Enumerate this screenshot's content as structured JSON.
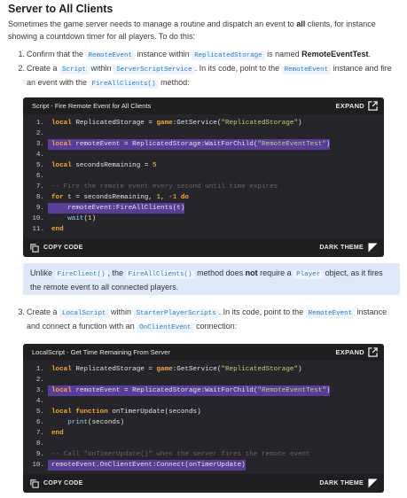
{
  "heading": "Server to All Clients",
  "intro": {
    "part1": "Sometimes the game server needs to manage a routine and dispatch an event to ",
    "bold": "all",
    "part2": " clients, for instance showing a countdown timer for all players. To do this:"
  },
  "steps": [
    {
      "num": "1.",
      "t1": "Confirm that the ",
      "tok1": "RemoteEvent",
      "t2": " instance within ",
      "tok2": "ReplicatedStorage",
      "t3": " is named ",
      "bold": "RemoteEventTest",
      "t4": "."
    },
    {
      "num": "2.",
      "t1": "Create a ",
      "tok1": "Script",
      "t2": " within ",
      "tok2": "ServerScriptService",
      "t3": ". In its code, point to the ",
      "tok3": "RemoteEvent",
      "t4": " instance and fire an event with the ",
      "tok4": "FireAllClients()",
      "t5": " method:"
    },
    {
      "num": "3.",
      "t1": "Create a ",
      "tok1": "LocalScript",
      "t2": " within ",
      "tok2": "StarterPlayerScripts",
      "t3": ". In its code, point to the ",
      "tok3": "RemoteEvent",
      "t4": " instance and connect a function with an ",
      "tok4": "OnClientEvent",
      "t5": " connection:"
    }
  ],
  "code_blocks": [
    {
      "title": "Script - Fire Remote Event for All Clients",
      "expand_label": "EXPAND",
      "copy_label": "COPY CODE",
      "theme_label": "DARK THEME",
      "lines": [
        "1.",
        "2.",
        "3.",
        "4.",
        "5.",
        "6.",
        "7.",
        "8.",
        "9.",
        "10.",
        "11."
      ]
    },
    {
      "title": "LocalScript - Get Time Remaining From Server",
      "expand_label": "EXPAND",
      "copy_label": "COPY CODE",
      "theme_label": "DARK THEME",
      "lines": [
        "1.",
        "2.",
        "3.",
        "4.",
        "5.",
        "6.",
        "7.",
        "8.",
        "9.",
        "10."
      ]
    }
  ],
  "note": {
    "t1": "Unlike ",
    "tok1": "FireClient()",
    "t2": ", the ",
    "tok2": "FireAllClients()",
    "t3": " method does ",
    "bold": "not",
    "t4": " require a ",
    "tok3": "Player",
    "t5": " object, as it fires the remote event to all connected players."
  },
  "colors": {
    "highlight": "#5a3d98",
    "note_bg": "#dde9f8",
    "code_bg": "#26262a",
    "keyword": "#f7a53a",
    "string": "#b5d67b",
    "inline_code": "#2b7bd1"
  },
  "icons": [
    "expand-icon",
    "copy-icon",
    "theme-icon"
  ]
}
